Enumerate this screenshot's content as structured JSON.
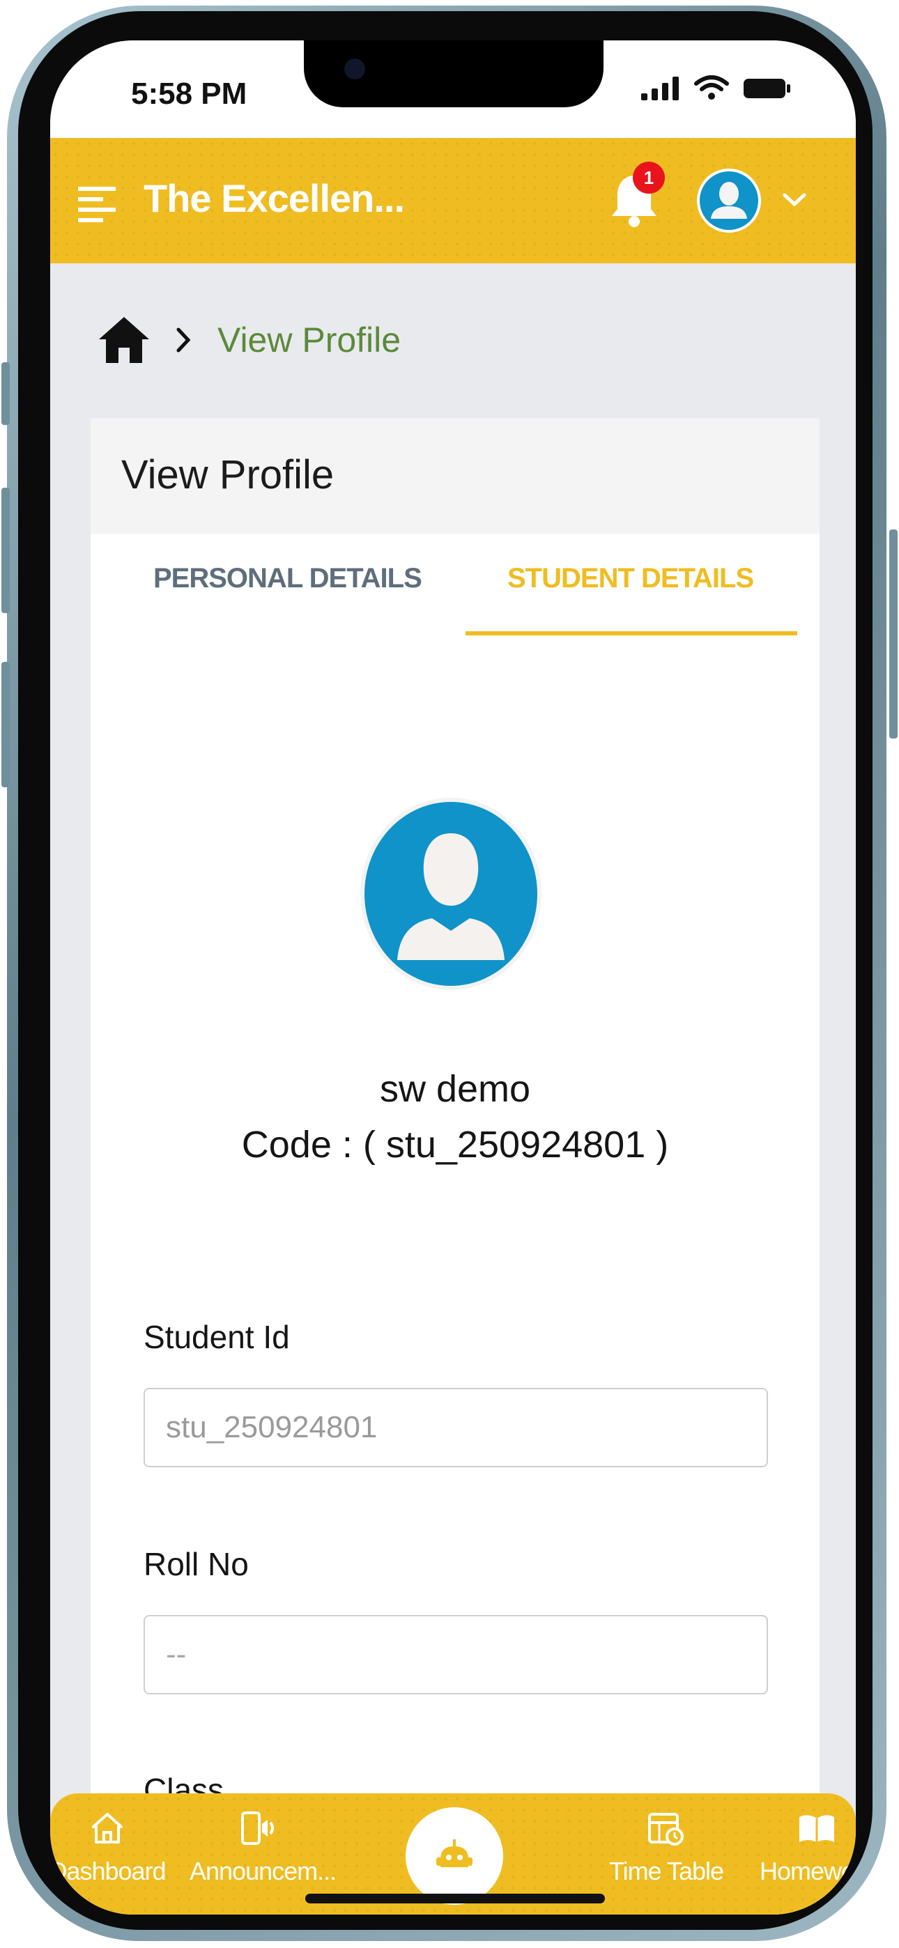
{
  "status_bar": {
    "time": "5:58 PM"
  },
  "app_bar": {
    "title": "The Excellen...",
    "notification_count": "1"
  },
  "breadcrumb": {
    "current": "View Profile"
  },
  "card": {
    "title": "View Profile",
    "tabs": [
      {
        "label": "PERSONAL DETAILS",
        "active": false
      },
      {
        "label": "STUDENT DETAILS",
        "active": true
      }
    ]
  },
  "profile": {
    "name": "sw demo",
    "code": "Code : ( stu_250924801 )"
  },
  "fields": {
    "student_id": {
      "label": "Student Id",
      "value": "stu_250924801"
    },
    "roll_no": {
      "label": "Roll No",
      "placeholder": "--"
    },
    "class": {
      "label": "Class"
    }
  },
  "bottom_nav": {
    "items": [
      {
        "label": "Dashboard",
        "icon": "home-icon"
      },
      {
        "label": "Announcem...",
        "icon": "announcement-icon"
      },
      {
        "label": "",
        "icon": "robot-icon"
      },
      {
        "label": "Time Table",
        "icon": "timetable-icon"
      },
      {
        "label": "Homework",
        "icon": "homework-icon"
      }
    ]
  },
  "colors": {
    "accent": "#efbd21",
    "avatar_blue": "#0f93c8",
    "breadcrumb_green": "#5a8a3a",
    "badge_red": "#e8131b"
  }
}
